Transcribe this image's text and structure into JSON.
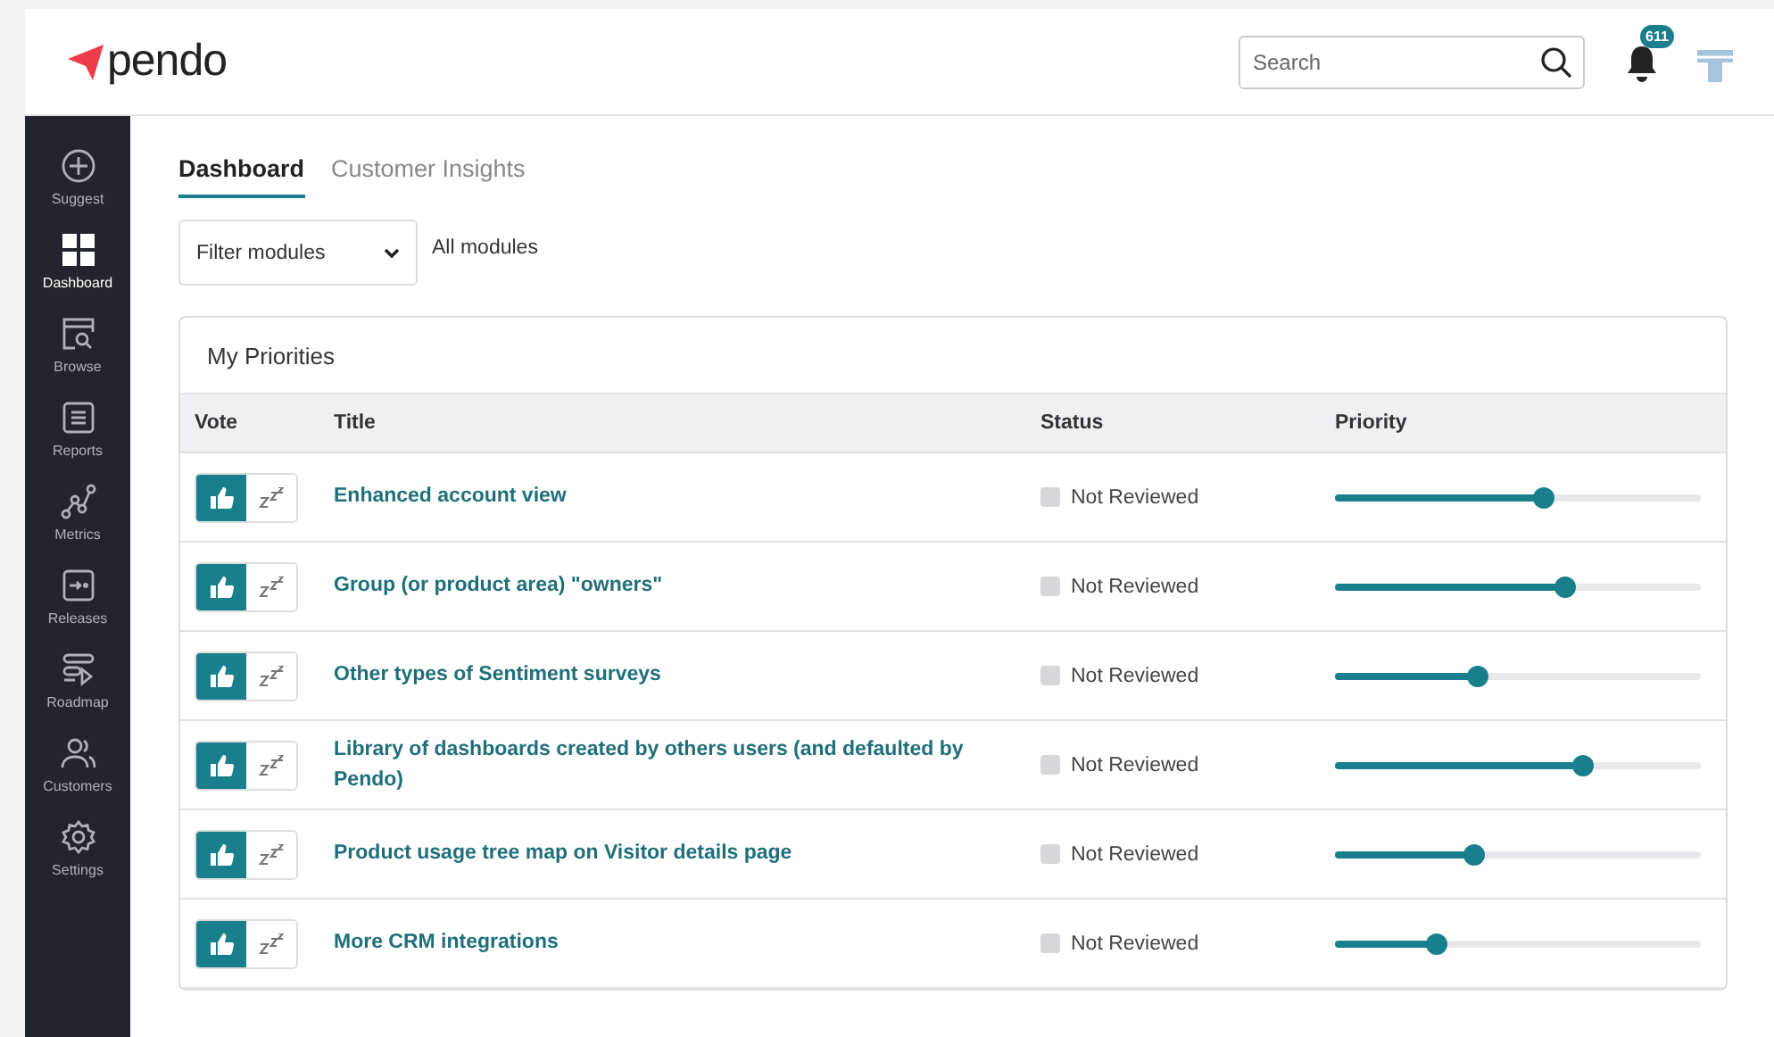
{
  "header": {
    "logo": "pendo",
    "search": {
      "placeholder": "Search"
    },
    "notifications": {
      "count": "611"
    }
  },
  "sidebar": {
    "items": [
      {
        "kind": "suggest",
        "label": "Suggest",
        "selected": false
      },
      {
        "kind": "dashboard",
        "label": "Dashboard",
        "selected": true
      },
      {
        "kind": "browse",
        "label": "Browse",
        "selected": false
      },
      {
        "kind": "reports",
        "label": "Reports",
        "selected": false
      },
      {
        "kind": "metrics",
        "label": "Metrics",
        "selected": false
      },
      {
        "kind": "releases",
        "label": "Releases",
        "selected": false
      },
      {
        "kind": "roadmap",
        "label": "Roadmap",
        "selected": false
      },
      {
        "kind": "customers",
        "label": "Customers",
        "selected": false
      },
      {
        "kind": "settings",
        "label": "Settings",
        "selected": false
      }
    ]
  },
  "tabs": [
    {
      "label": "Dashboard",
      "selected": true
    },
    {
      "label": "Customer Insights",
      "selected": false
    }
  ],
  "filter": {
    "label": "Filter modules",
    "value": "All modules"
  },
  "table": {
    "title": "My Priorities",
    "columns": [
      "Vote",
      "Title",
      "Status",
      "Priority"
    ],
    "rows": [
      {
        "upvoted": true,
        "title": "Enhanced account view",
        "status": "Not Reviewed",
        "reviewed": false,
        "level": 0.57
      },
      {
        "upvoted": true,
        "title": "Group (or product area) \"owners\"",
        "status": "Not Reviewed",
        "reviewed": false,
        "level": 0.63
      },
      {
        "upvoted": true,
        "title": "Other types of Sentiment surveys",
        "status": "Not Reviewed",
        "reviewed": false,
        "level": 0.39
      },
      {
        "upvoted": true,
        "title": "Library of dashboards created by others users (and defaulted by Pendo)",
        "status": "Not Reviewed",
        "reviewed": false,
        "level": 0.68
      },
      {
        "upvoted": true,
        "title": "Product usage tree map on Visitor details page",
        "status": "Not Reviewed",
        "reviewed": false,
        "level": 0.38
      },
      {
        "upvoted": true,
        "title": "More CRM integrations",
        "status": "Not Reviewed",
        "reviewed": false,
        "level": 0.28
      }
    ]
  }
}
